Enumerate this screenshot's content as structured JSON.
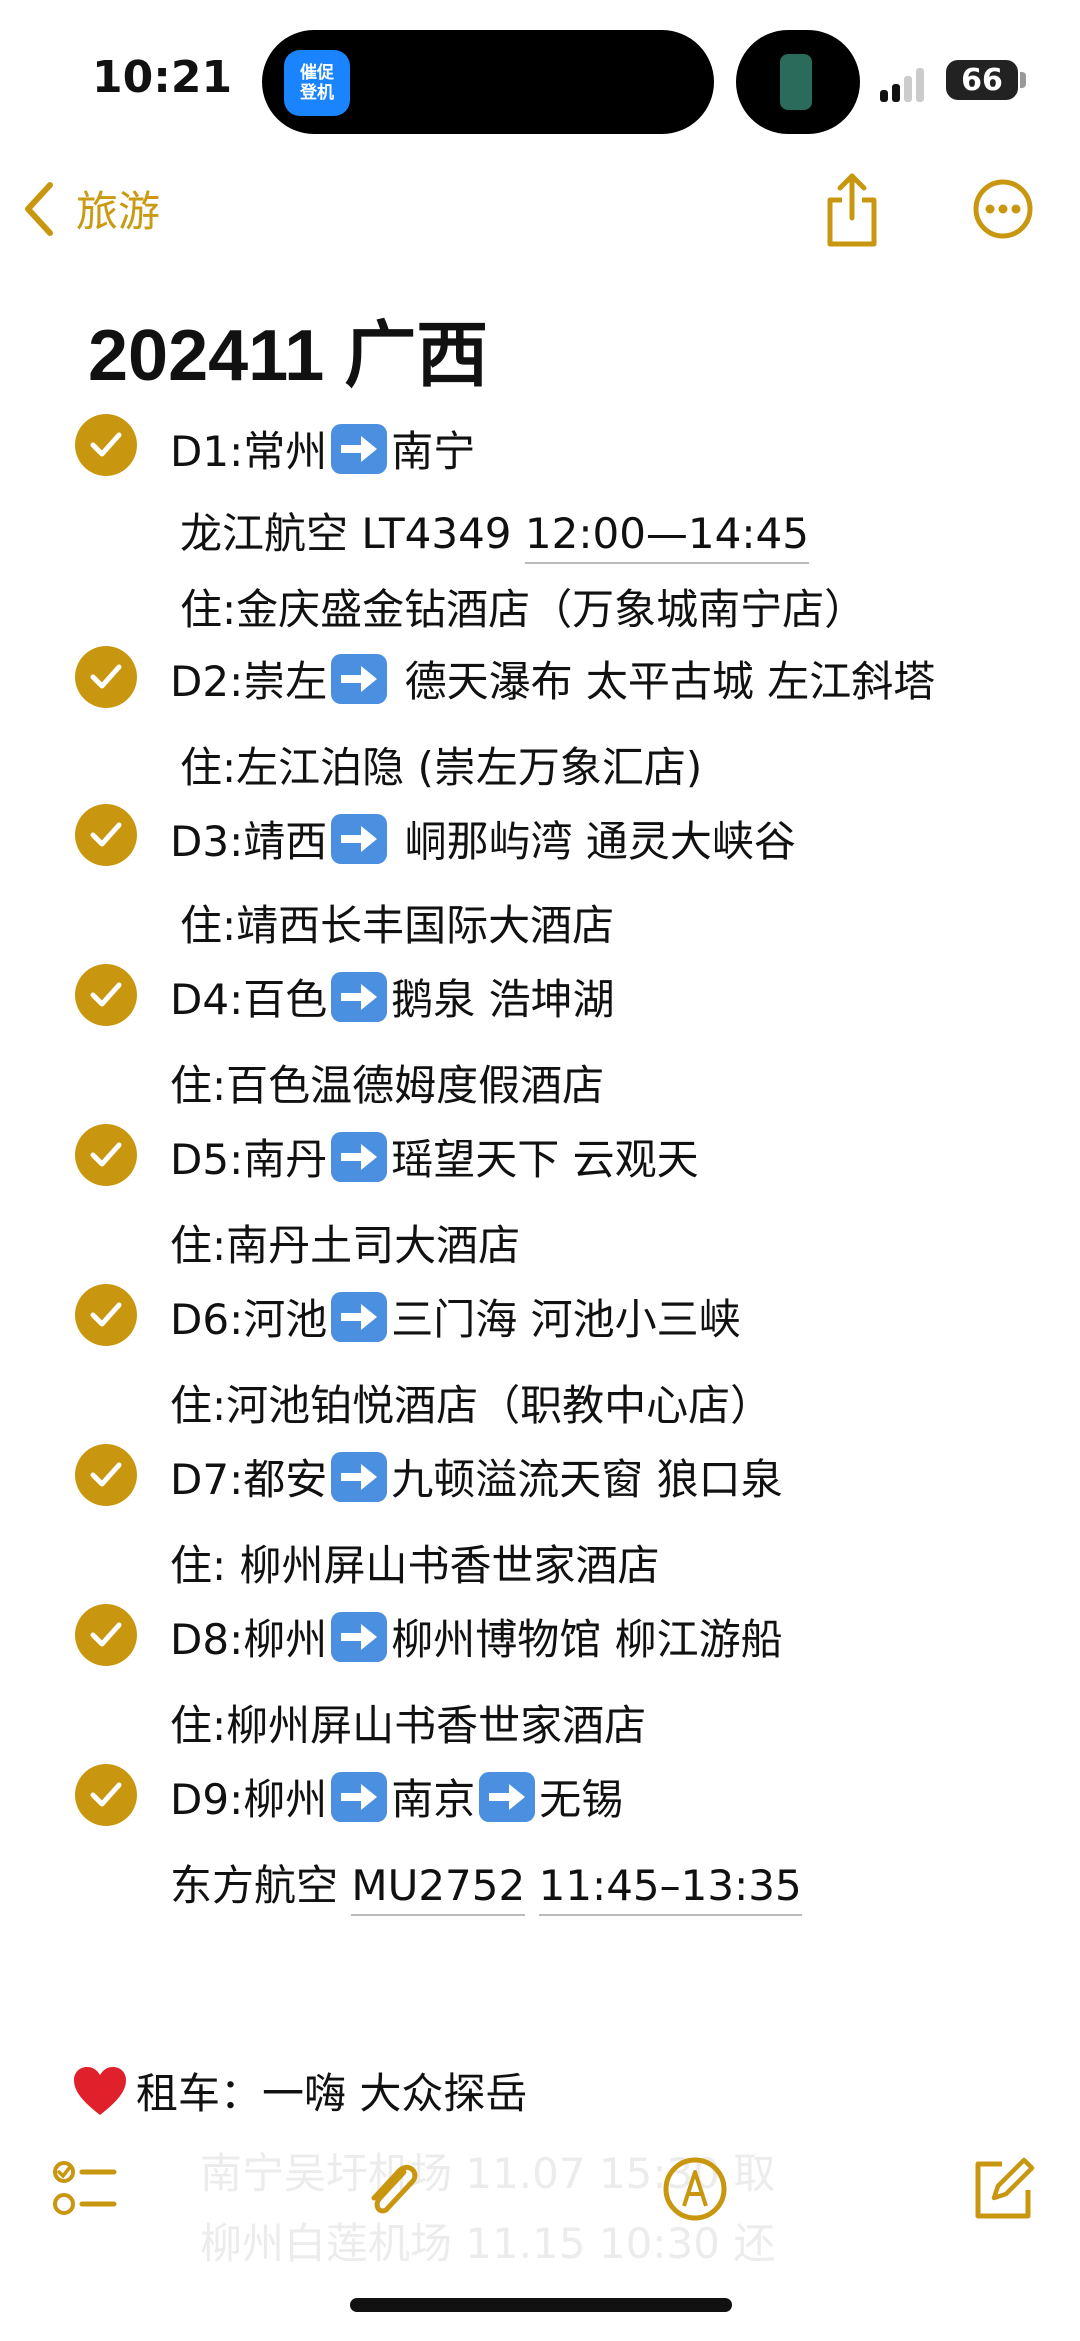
{
  "status_bar": {
    "time": "10:21",
    "island_app": "催促\n登机",
    "island_app_l1": "催促",
    "island_app_l2": "登机",
    "battery": "66"
  },
  "nav": {
    "back_label": "旅游",
    "share_icon": "share-icon",
    "more_icon": "ellipsis-circle-icon"
  },
  "note": {
    "title": "202411 广西",
    "accent_color": "#c9970f",
    "days": [
      {
        "head_a": "D1:常州",
        "head_b": "南宁",
        "details": [
          {
            "pre": "龙江航空 LT4349 ",
            "underlined": "12:00—14:45"
          },
          {
            "pre": "住:金庆盛金钻酒店（万象城南宁店）"
          }
        ]
      },
      {
        "head_a": "D2:崇左",
        "head_b": " 德天瀑布 太平古城 左江斜塔",
        "details": [
          {
            "pre": "住:左江泊隐 (崇左万象汇店)"
          }
        ]
      },
      {
        "head_a": "D3:靖西",
        "head_b": " 峒那屿湾 通灵大峡谷",
        "details": [
          {
            "pre": "住:靖西长丰国际大酒店"
          }
        ]
      },
      {
        "head_a": "D4:百色",
        "head_b": "鹅泉 浩坤湖",
        "details": [
          {
            "pre": "住:百色温德姆度假酒店"
          }
        ]
      },
      {
        "head_a": "D5:南丹",
        "head_b": "瑶望天下 云观天",
        "details": [
          {
            "pre": "住:南丹土司大酒店"
          }
        ]
      },
      {
        "head_a": "D6:河池",
        "head_b": "三门海 河池小三峡",
        "details": [
          {
            "pre": "住:河池铂悦酒店（职教中心店）"
          }
        ]
      },
      {
        "head_a": "D7:都安",
        "head_b": "九顿溢流天窗 狼口泉",
        "details": [
          {
            "pre": "住: 柳州屏山书香世家酒店"
          }
        ]
      },
      {
        "head_a": "D8:柳州",
        "head_b": "柳州博物馆 柳江游船",
        "details": [
          {
            "pre": "住:柳州屏山书香世家酒店"
          }
        ]
      },
      {
        "head_a": "D9:柳州",
        "head_b": "南京",
        "head_c": "无锡",
        "details": [
          {
            "pre": "东方航空 ",
            "underlined": "MU2752",
            "mid": " ",
            "underlined2": "11:45–13:35"
          }
        ]
      }
    ],
    "rental": "租车：一嗨 大众探岳",
    "faded_lines": [
      "南宁吴圩机场 11.07 15:30 取",
      "柳州白莲机场 11.15 10:30 还"
    ]
  },
  "toolbar": {
    "items": [
      "checklist-icon",
      "paperclip-icon",
      "markup-pen-icon",
      "compose-icon"
    ]
  }
}
